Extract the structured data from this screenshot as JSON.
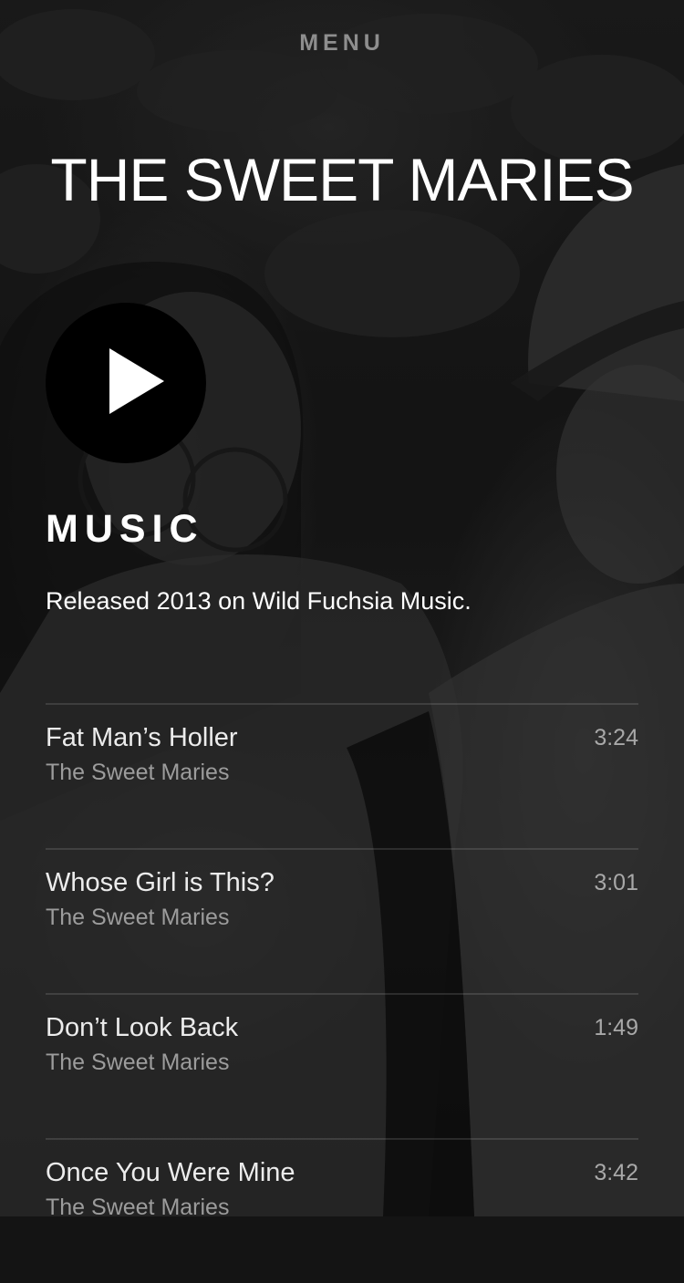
{
  "header": {
    "menu_label": "MENU",
    "site_title": "THE SWEET MARIES"
  },
  "player": {
    "play_icon": "play-icon"
  },
  "music": {
    "heading": "MUSIC",
    "release_info": "Released 2013 on Wild Fuchsia Music."
  },
  "tracks": [
    {
      "title": "Fat Man’s Holler",
      "artist": "The Sweet Maries",
      "duration": "3:24"
    },
    {
      "title": "Whose Girl is This?",
      "artist": "The Sweet Maries",
      "duration": "3:01"
    },
    {
      "title": "Don’t Look Back",
      "artist": "The Sweet Maries",
      "duration": "1:49"
    },
    {
      "title": "Once You Were Mine",
      "artist": "The Sweet Maries",
      "duration": "3:42"
    }
  ],
  "colors": {
    "background": "#1c1c1c",
    "text_primary": "#ffffff",
    "text_secondary": "#9c9c9c",
    "menu_text": "#8e8e8e",
    "play_button": "#000000"
  }
}
